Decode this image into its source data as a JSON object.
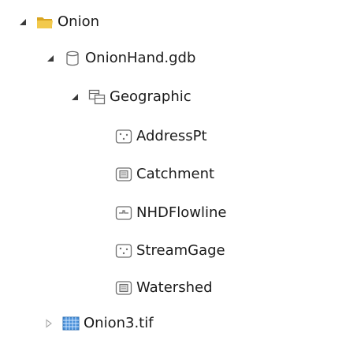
{
  "tree": {
    "nodes": [
      {
        "label": "Onion",
        "icon": "folder-open-icon",
        "expanded": true
      },
      {
        "label": "OnionHand.gdb",
        "icon": "database-icon",
        "expanded": true
      },
      {
        "label": "Geographic",
        "icon": "feature-dataset-icon",
        "expanded": true
      },
      {
        "label": "AddressPt",
        "icon": "point-feature-class-icon"
      },
      {
        "label": "Catchment",
        "icon": "polygon-feature-class-icon"
      },
      {
        "label": "NHDFlowline",
        "icon": "line-feature-class-icon"
      },
      {
        "label": "StreamGage",
        "icon": "point-feature-class-icon"
      },
      {
        "label": "Watershed",
        "icon": "polygon-feature-class-icon"
      },
      {
        "label": "Onion3.tif",
        "icon": "raster-icon",
        "expanded": false
      }
    ]
  },
  "colors": {
    "folder": "#f2c94c",
    "folder_dark": "#d9a521",
    "icon_stroke": "#6e6e6e",
    "toggle_expanded": "#3a3a3a",
    "toggle_collapsed": "#a8a8a8",
    "raster_fill": "#4a90d9",
    "raster_grid": "#cfe6ff"
  }
}
